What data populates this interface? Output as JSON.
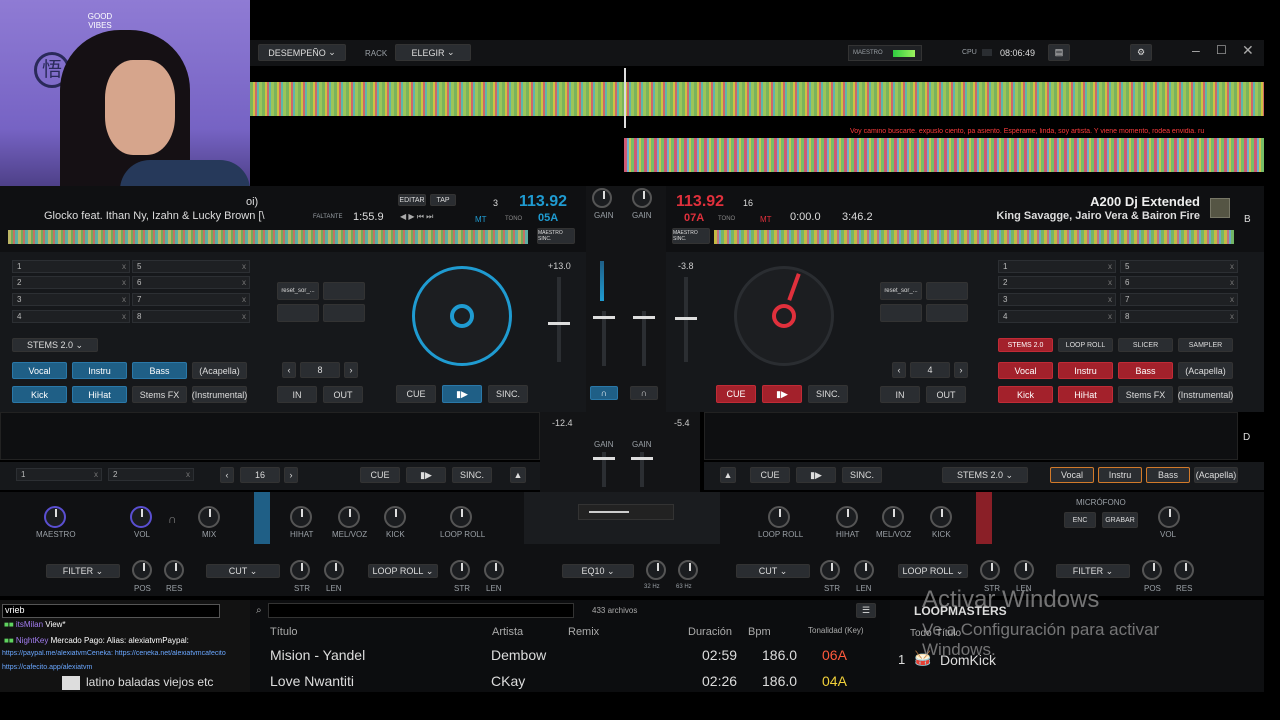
{
  "topbar": {
    "mode": "DESEMPEÑO",
    "rack_label": "RACK",
    "rack_value": "ELEGIR",
    "master_label": "MAESTRO",
    "cpu_label": "CPU",
    "clock": "08:06:49"
  },
  "lyrics": "Voy camino buscarte. expuslo ciento, pa asiento. Espérame, linda, soy artista. Y viene momento, rodea envidia. ru",
  "webcam_sign": "GOOD VIBES",
  "deck_left": {
    "title_frag": "oi)",
    "artist": "Glocko feat. Ithan Ny, Izahn & Lucky Brown [\\",
    "remaining_label": "FALTANTE",
    "remaining": "1:55.9",
    "edit": "EDITAR",
    "tap": "TAP",
    "bpm": "113.92",
    "bpm_small": "3",
    "key": "05A",
    "mt": "MT",
    "tone": "TONO",
    "master_sync": "MAESTRO SINC.",
    "pitch": "+13.0",
    "hotcues": [
      "1",
      "2",
      "3",
      "4",
      "5",
      "6",
      "7",
      "8"
    ],
    "stems_select": "STEMS 2.0",
    "stems": [
      "Vocal",
      "Instru",
      "Bass",
      "(Acapella)",
      "Kick",
      "HiHat",
      "Stems FX",
      "(Instrumental)"
    ],
    "loop_value": "8",
    "loop_in": "IN",
    "loop_out": "OUT",
    "cue": "CUE",
    "sync": "SINC.",
    "pad_label": "reset_sor_..."
  },
  "deck_right": {
    "bpm": "113.92",
    "bpm_small": "16",
    "key": "07A",
    "mt": "MT",
    "tone": "TONO",
    "elapsed": "0:00.0",
    "total": "3:46.2",
    "title": "A200 Dj Extended",
    "artist": "King Savagge, Jairo Vera & Bairon Fire",
    "side": "B",
    "master_sync": "MAESTRO SINC.",
    "pitch": "-3.8",
    "hotcues": [
      "1",
      "2",
      "3",
      "4",
      "5",
      "6",
      "7",
      "8"
    ],
    "pad_modes": [
      "STEMS 2.0",
      "LOOP ROLL",
      "SLICER",
      "SAMPLER"
    ],
    "stems": [
      "Vocal",
      "Instru",
      "Bass",
      "(Acapella)",
      "Kick",
      "HiHat",
      "Stems FX",
      "(Instrumental)"
    ],
    "loop_value": "4",
    "loop_in": "IN",
    "loop_out": "OUT",
    "cue": "CUE",
    "sync": "SINC.",
    "pad_label": "reset_sor_..."
  },
  "mixer": {
    "gain": "GAIN",
    "pitch_c": "-12.4",
    "pitch_d": "-5.4"
  },
  "deck_c": {
    "hot1": "1",
    "hot2": "2",
    "loop_value": "16",
    "cue": "CUE",
    "sync": "SINC."
  },
  "deck_d": {
    "cue": "CUE",
    "sync": "SINC.",
    "stems_select": "STEMS 2.0",
    "stems": [
      "Vocal",
      "Instru",
      "Bass",
      "(Acapella)"
    ],
    "side": "D"
  },
  "fx_bar": {
    "maestro": "MAESTRO",
    "vol": "VOL",
    "mix": "MIX",
    "hihat": "HIHAT",
    "melvoz": "MEL/VOZ",
    "kick": "KICK",
    "loop_roll": "LOOP ROLL",
    "mic": "MICRÓFONO",
    "enc": "ENC",
    "grabar": "GRABAR",
    "vol_r": "VOL",
    "left_filter": "FILTER",
    "pos": "POS",
    "res": "RES",
    "cut": "CUT",
    "str": "STR",
    "len": "LEN",
    "loop_roll_sel": "LOOP ROLL",
    "eq": "EQ10",
    "hz32": "32 Hz",
    "hz63": "63 Hz"
  },
  "browser": {
    "file_count": "433 archivos",
    "columns": [
      "Título",
      "Artista",
      "Remix",
      "Duración",
      "Bpm",
      "Tonalidad (Key)"
    ],
    "rows": [
      {
        "title": "Mision - Yandel",
        "artist": "Dembow",
        "duration": "02:59",
        "bpm": "186.0",
        "key": "06A"
      },
      {
        "title": "Love Nwantiti",
        "artist": "CKay",
        "duration": "02:26",
        "bpm": "186.0",
        "key": "04A"
      }
    ],
    "sidebar_title": "LOOPMASTERS",
    "side_col": "Todo",
    "side_col2": "Título",
    "side_item_num": "1",
    "side_item": "DomKick"
  },
  "chat": {
    "input_value": "vrieb",
    "lines": [
      {
        "user": "itsMilan",
        "text": "View*"
      },
      {
        "user": "NightKey",
        "text": "Mercado Pago: Alias: alexiatvmPaypal:"
      },
      {
        "user": "",
        "text": "https://paypal.me/alexiatvmCeneka: https://ceneka.net/alexiatvmcafecito"
      },
      {
        "user": "",
        "text": "https://cafecito.app/alexiatvm"
      }
    ],
    "playlist_item": "latino baladas viejos etc"
  },
  "watermark": {
    "line1": "Activar Windows",
    "line2": "Ve a Configuración para activar",
    "line3": "Windows."
  },
  "colors": {
    "blue": "#1f9bd1",
    "red": "#e0303c",
    "key_orange": "#ff5a3c",
    "key_yellow": "#f2d13a"
  }
}
